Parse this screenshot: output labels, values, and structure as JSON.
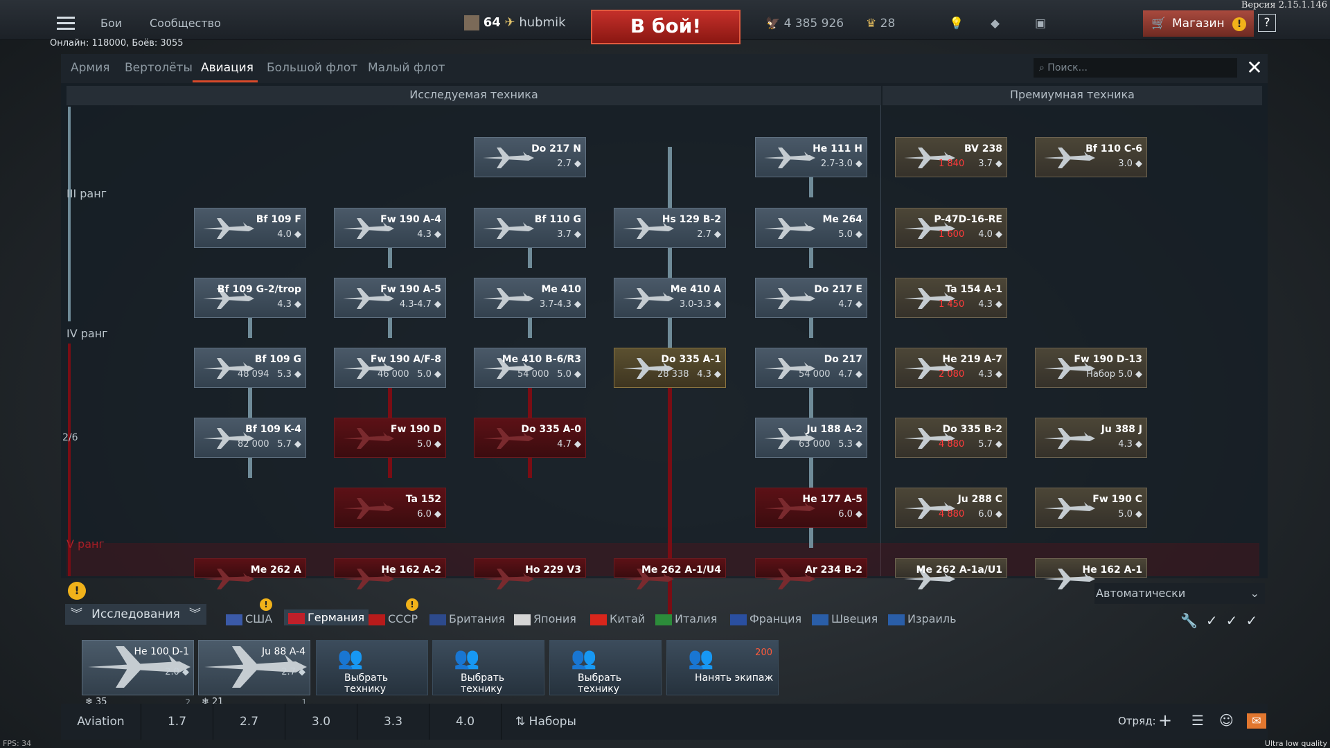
{
  "version": "Версия 2.15.1.146",
  "topnav": {
    "battles": "Бои",
    "community": "Сообщество"
  },
  "online": "Онлайн: 118000, Боёв: 3055",
  "player": {
    "level": "64",
    "name": "hubmik"
  },
  "battle_button": "В бой!",
  "currency": {
    "silver": "4 385 926",
    "gold": "28"
  },
  "shop": {
    "label": "Магазин",
    "alert": "!"
  },
  "help": "?",
  "tabs": [
    "Армия",
    "Вертолёты",
    "Авиация",
    "Большой флот",
    "Малый флот"
  ],
  "active_tab": "Авиация",
  "search_placeholder": "Поиск...",
  "col_heads": {
    "research": "Исследуемая техника",
    "premium": "Премиумная техника"
  },
  "ranks": {
    "r3": "III ранг",
    "r4": "IV ранг",
    "progress": "2/6",
    "r5": "V ранг"
  },
  "research_cards": [
    {
      "name": "Do 217 N",
      "br": "2.7",
      "state": "normal"
    },
    {
      "name": "He 111 H",
      "br": "2.7-3.0",
      "state": "normal"
    },
    {
      "name": "Bf 109 F",
      "br": "4.0",
      "state": "normal"
    },
    {
      "name": "Fw 190 A-4",
      "br": "4.3",
      "state": "normal"
    },
    {
      "name": "Bf 110 G",
      "br": "3.7",
      "state": "normal"
    },
    {
      "name": "Hs 129 B-2",
      "br": "2.7",
      "state": "normal"
    },
    {
      "name": "Me 264",
      "br": "5.0",
      "state": "normal"
    },
    {
      "name": "Bf 109 G-2/trop",
      "br": "4.3",
      "state": "normal"
    },
    {
      "name": "Fw 190 A-5",
      "br": "4.3-4.7",
      "state": "normal"
    },
    {
      "name": "Me 410",
      "br": "3.7-4.3",
      "state": "normal"
    },
    {
      "name": "Me 410 A",
      "br": "3.0-3.3",
      "state": "normal"
    },
    {
      "name": "Do 217 E",
      "br": "4.7",
      "state": "normal"
    },
    {
      "name": "Bf 109 G",
      "br": "5.3",
      "cost": "48 094",
      "state": "normal"
    },
    {
      "name": "Fw 190 A/F-8",
      "br": "5.0",
      "cost": "46 000",
      "state": "normal"
    },
    {
      "name": "Me 410 B-6/R3",
      "br": "5.0",
      "cost": "54 000",
      "state": "normal"
    },
    {
      "name": "Do 335 A-1",
      "br": "4.3",
      "cost": "28 338",
      "state": "gold"
    },
    {
      "name": "Do 217",
      "br": "4.7",
      "cost": "54 000",
      "state": "normal"
    },
    {
      "name": "Bf 109 K-4",
      "br": "5.7",
      "cost": "82 000",
      "state": "normal"
    },
    {
      "name": "Fw 190 D",
      "br": "5.0",
      "state": "red"
    },
    {
      "name": "Do 335 A-0",
      "br": "4.7",
      "state": "red"
    },
    {
      "name": "Ju 188 A-2",
      "br": "5.3",
      "cost": "63 000",
      "state": "normal"
    },
    {
      "name": "Ta 152",
      "br": "6.0",
      "state": "red"
    },
    {
      "name": "He 177 A-5",
      "br": "6.0",
      "state": "red"
    },
    {
      "name": "Me 262 A",
      "br": "",
      "state": "red"
    },
    {
      "name": "He 162 A-2",
      "br": "",
      "state": "red"
    },
    {
      "name": "Ho 229 V3",
      "br": "",
      "state": "red"
    },
    {
      "name": "Me 262 A-1/U4",
      "br": "",
      "state": "red"
    },
    {
      "name": "Ar 234 B-2",
      "br": "",
      "state": "red"
    }
  ],
  "premium_cards": [
    {
      "name": "BV 238",
      "br": "3.7",
      "cost": "1 840"
    },
    {
      "name": "Bf 110 C-6",
      "br": "3.0",
      "cost": ""
    },
    {
      "name": "P-47D-16-RE",
      "br": "4.0",
      "cost": "1 600"
    },
    {
      "name": "Ta 154 A-1",
      "br": "4.3",
      "cost": "1 450"
    },
    {
      "name": "He 219 A-7",
      "br": "4.3",
      "cost": "2 080"
    },
    {
      "name": "Fw 190 D-13",
      "br": "Набор 5.0",
      "cost": ""
    },
    {
      "name": "Do 335 B-2",
      "br": "5.7",
      "cost": "4 880"
    },
    {
      "name": "Ju 388 J",
      "br": "4.3",
      "cost": ""
    },
    {
      "name": "Ju 288 C",
      "br": "6.0",
      "cost": "4 880"
    },
    {
      "name": "Fw 190 C",
      "br": "5.0",
      "cost": ""
    },
    {
      "name": "Me 262 A-1a/U1",
      "br": "",
      "cost": ""
    },
    {
      "name": "He 162 A-1",
      "br": "",
      "cost": ""
    }
  ],
  "research_dropdown": "Автоматически",
  "research_label": "Исследования",
  "nations": [
    "США",
    "Германия",
    "СССР",
    "Британия",
    "Япония",
    "Китай",
    "Италия",
    "Франция",
    "Швеция",
    "Израиль"
  ],
  "active_nation": "Германия",
  "crew_slots": [
    {
      "name": "He 100 D-1",
      "br": "2.0",
      "crew": "35",
      "n": "2"
    },
    {
      "name": "Ju 88 A-4",
      "br": "2.7",
      "crew": "21",
      "n": "1"
    },
    {
      "name": "Выбрать технику"
    },
    {
      "name": "Выбрать технику"
    },
    {
      "name": "Выбрать технику"
    },
    {
      "name": "Нанять экипаж",
      "cost": "200"
    }
  ],
  "bottom": {
    "mode": "Aviation",
    "brs": [
      "1.7",
      "2.7",
      "3.0",
      "3.3",
      "4.0"
    ],
    "sets": "Наборы",
    "squad": "Отряд:"
  },
  "fps": "FPS: 34",
  "quality": "Ultra low quality"
}
